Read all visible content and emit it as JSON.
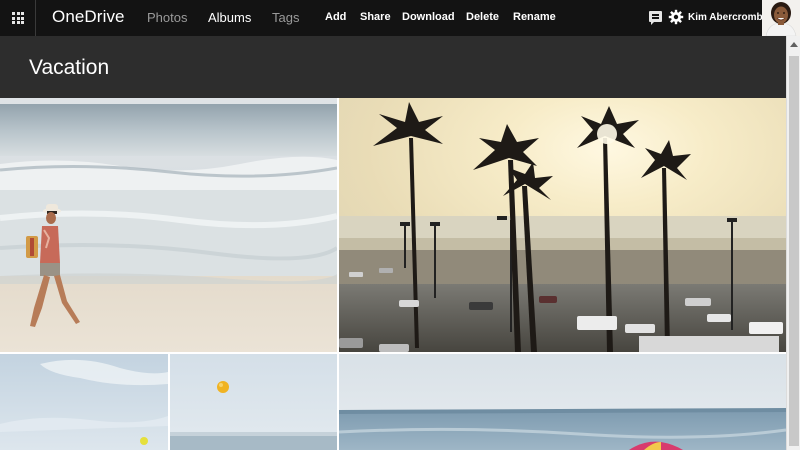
{
  "app": {
    "brand": "OneDrive",
    "nav": {
      "photos": "Photos",
      "albums": "Albums",
      "tags": "Tags",
      "active": "Albums"
    },
    "commands": {
      "add": "Add",
      "share": "Share",
      "download": "Download",
      "delete": "Delete",
      "rename": "Rename"
    },
    "user": {
      "name": "Kim Abercrombie"
    },
    "icons": [
      "waffle-menu-icon",
      "feedback-icon",
      "gear-icon",
      "avatar"
    ]
  },
  "album": {
    "title": "Vacation",
    "photos": [
      {
        "name": "photo-beach-walker"
      },
      {
        "name": "photo-palm-trees-sunset"
      },
      {
        "name": "photo-sky-tennis-ball"
      },
      {
        "name": "photo-yellow-balloon"
      },
      {
        "name": "photo-sea-umbrella"
      }
    ]
  },
  "colors": {
    "topbar": "#131313",
    "titlebar": "#2d2d2d",
    "nav_inactive": "#9a9a9a",
    "text": "#ffffff"
  }
}
